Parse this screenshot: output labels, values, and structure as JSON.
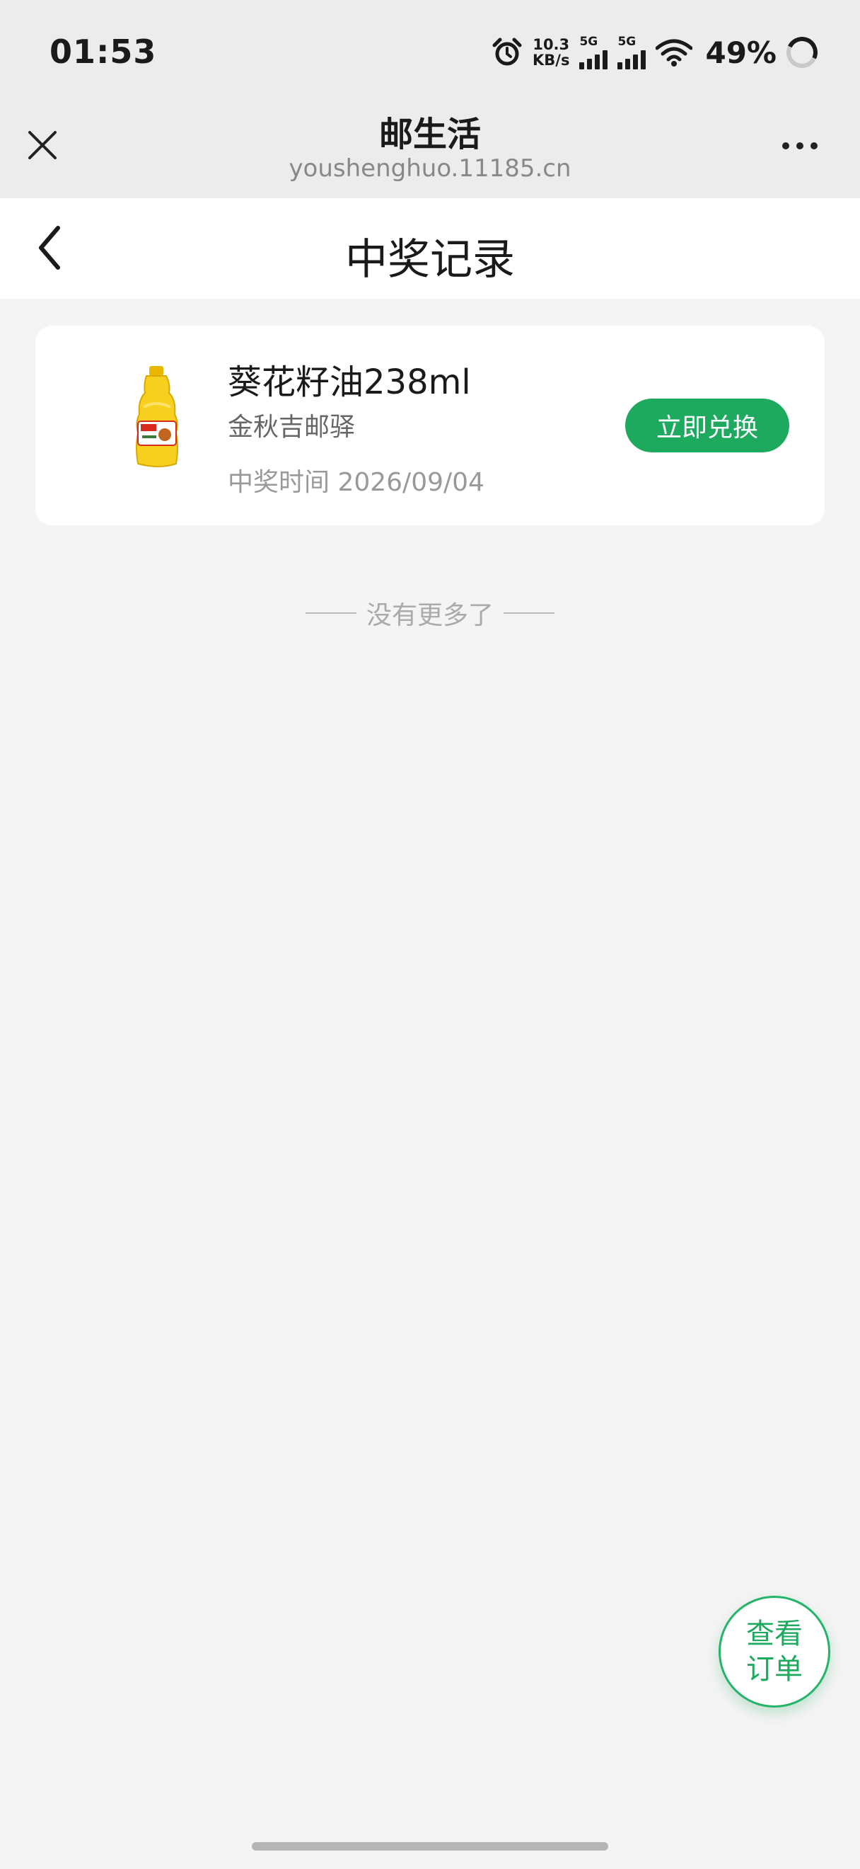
{
  "status_bar": {
    "time": "01:53",
    "net_speed_value": "10.3",
    "net_speed_unit": "KB/s",
    "sim1_tag": "5G",
    "sim2_tag": "5G",
    "battery": "49%",
    "icons": [
      "alarm-icon",
      "signal-icon",
      "wifi-icon",
      "battery-icon"
    ]
  },
  "webview": {
    "title": "邮生活",
    "url": "youshenghuo.11185.cn",
    "icons": [
      "close-icon",
      "more-icon"
    ]
  },
  "page": {
    "title": "中奖记录",
    "back_icon": "chevron-left-icon"
  },
  "records": [
    {
      "name": "葵花籽油238ml",
      "shop": "金秋吉邮驿",
      "time_label": "中奖时间 2026/09/04",
      "action": "立即兑换",
      "image": "sunflower-oil-bottle"
    }
  ],
  "list_end": "没有更多了",
  "float_button": {
    "line1": "查看",
    "line2": "订单"
  },
  "colors": {
    "accent": "#1eaa5e",
    "background": "#f4f4f4",
    "header_bg": "#ececec"
  }
}
